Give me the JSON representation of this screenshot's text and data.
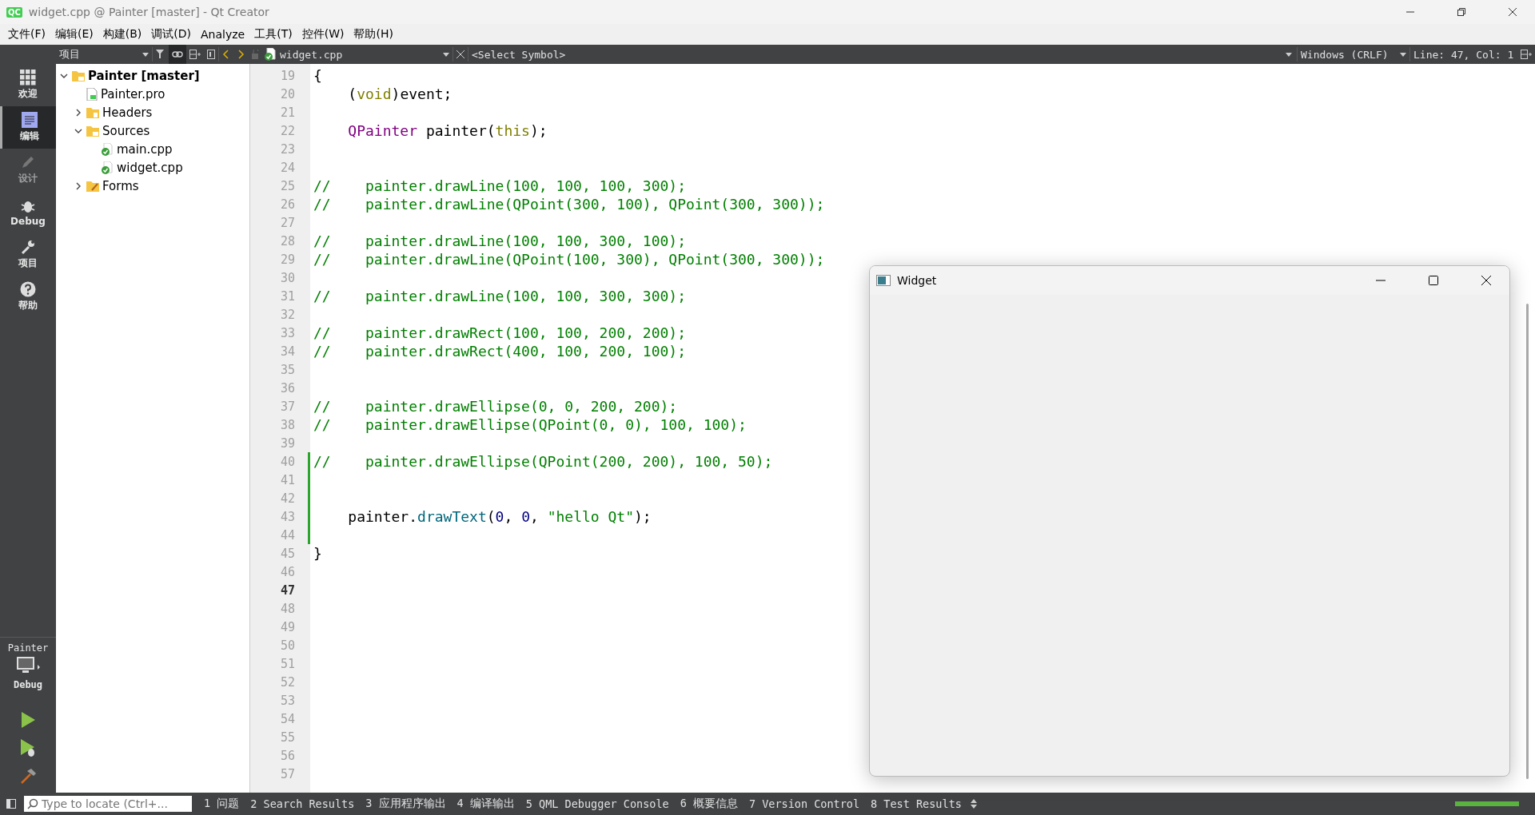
{
  "window": {
    "logo": "QC",
    "title": "widget.cpp @ Painter [master] - Qt Creator"
  },
  "menu": [
    "文件(F)",
    "编辑(E)",
    "构建(B)",
    "调试(D)",
    "Analyze",
    "工具(T)",
    "控件(W)",
    "帮助(H)"
  ],
  "toolbar": {
    "sidebar_view": "项目",
    "file": "widget.cpp",
    "symbol": "<Select Symbol>",
    "line_ending": "Windows (CRLF)",
    "position": "Line: 47, Col: 1"
  },
  "modes": [
    {
      "label": "欢迎",
      "kind": "grid",
      "selected": false,
      "disabled": false
    },
    {
      "label": "编辑",
      "kind": "doc",
      "selected": true,
      "disabled": false
    },
    {
      "label": "设计",
      "kind": "pencil",
      "selected": false,
      "disabled": true
    },
    {
      "label": "Debug",
      "kind": "bug",
      "selected": false,
      "disabled": false
    },
    {
      "label": "项目",
      "kind": "wrench",
      "selected": false,
      "disabled": false
    },
    {
      "label": "帮助",
      "kind": "help",
      "selected": false,
      "disabled": false
    }
  ],
  "kit": {
    "project": "Painter",
    "build": "Debug"
  },
  "tree": [
    {
      "label": "Painter [master]",
      "kind": "project",
      "expanded": true,
      "children": [
        {
          "label": "Painter.pro",
          "kind": "pro"
        },
        {
          "label": "Headers",
          "kind": "headers",
          "expanded": false
        },
        {
          "label": "Sources",
          "kind": "sources",
          "expanded": true,
          "children": [
            {
              "label": "main.cpp",
              "kind": "cpp"
            },
            {
              "label": "widget.cpp",
              "kind": "cpp"
            }
          ]
        },
        {
          "label": "Forms",
          "kind": "forms",
          "expanded": false
        }
      ]
    }
  ],
  "editor": {
    "lines": [
      {
        "number": "19",
        "current": false,
        "modified": false,
        "tokens": [
          {
            "t": "{",
            "kind": "plain"
          }
        ]
      },
      {
        "number": "20",
        "current": false,
        "modified": false,
        "tokens": [
          {
            "t": "    (",
            "kind": "plain"
          },
          {
            "t": "void",
            "kind": "keyword"
          },
          {
            "t": ")event;",
            "kind": "plain"
          }
        ]
      },
      {
        "number": "21",
        "current": false,
        "modified": false
      },
      {
        "number": "22",
        "current": false,
        "modified": false,
        "tokens": [
          {
            "t": "    QPainter",
            "kind": "type"
          },
          {
            "t": " painter(",
            "kind": "plain"
          },
          {
            "t": "this",
            "kind": "keyword"
          },
          {
            "t": ");",
            "kind": "plain"
          }
        ]
      },
      {
        "number": "23",
        "current": false,
        "modified": false
      },
      {
        "number": "24",
        "current": false,
        "modified": false
      },
      {
        "number": "25",
        "current": false,
        "modified": false,
        "tokens": [
          {
            "t": "//    painter.drawLine(100, 100, 100, 300);",
            "kind": "comment"
          }
        ]
      },
      {
        "number": "26",
        "current": false,
        "modified": false,
        "tokens": [
          {
            "t": "//    painter.drawLine(QPoint(300, 100), QPoint(300, 300));",
            "kind": "comment"
          }
        ]
      },
      {
        "number": "27",
        "current": false,
        "modified": false
      },
      {
        "number": "28",
        "current": false,
        "modified": false,
        "tokens": [
          {
            "t": "//    painter.drawLine(100, 100, 300, 100);",
            "kind": "comment"
          }
        ]
      },
      {
        "number": "29",
        "current": false,
        "modified": false,
        "tokens": [
          {
            "t": "//    painter.drawLine(QPoint(100, 300), QPoint(300, 300));",
            "kind": "comment"
          }
        ]
      },
      {
        "number": "30",
        "current": false,
        "modified": false
      },
      {
        "number": "31",
        "current": false,
        "modified": false,
        "tokens": [
          {
            "t": "//    painter.drawLine(100, 100, 300, 300);",
            "kind": "comment"
          }
        ]
      },
      {
        "number": "32",
        "current": false,
        "modified": false
      },
      {
        "number": "33",
        "current": false,
        "modified": false,
        "tokens": [
          {
            "t": "//    painter.drawRect(100, 100, 200, 200);",
            "kind": "comment"
          }
        ]
      },
      {
        "number": "34",
        "current": false,
        "modified": false,
        "tokens": [
          {
            "t": "//    painter.drawRect(400, 100, 200, 100);",
            "kind": "comment"
          }
        ]
      },
      {
        "number": "35",
        "current": false,
        "modified": false
      },
      {
        "number": "36",
        "current": false,
        "modified": false
      },
      {
        "number": "37",
        "current": false,
        "modified": false,
        "tokens": [
          {
            "t": "//    painter.drawEllipse(0, 0, 200, 200);",
            "kind": "comment"
          }
        ]
      },
      {
        "number": "38",
        "current": false,
        "modified": false,
        "tokens": [
          {
            "t": "//    painter.drawEllipse(QPoint(0, 0), 100, 100);",
            "kind": "comment"
          }
        ]
      },
      {
        "number": "39",
        "current": false,
        "modified": false
      },
      {
        "number": "40",
        "current": false,
        "modified": true,
        "tokens": [
          {
            "t": "//    painter.drawEllipse(QPoint(200, 200), 100, 50);",
            "kind": "comment"
          }
        ]
      },
      {
        "number": "41",
        "current": false,
        "modified": true
      },
      {
        "number": "42",
        "current": false,
        "modified": true
      },
      {
        "number": "43",
        "current": false,
        "modified": true,
        "tokens": [
          {
            "t": "    painter.",
            "kind": "plain"
          },
          {
            "t": "drawText",
            "kind": "function"
          },
          {
            "t": "(",
            "kind": "plain"
          },
          {
            "t": "0",
            "kind": "number"
          },
          {
            "t": ", ",
            "kind": "plain"
          },
          {
            "t": "0",
            "kind": "number"
          },
          {
            "t": ", ",
            "kind": "plain"
          },
          {
            "t": "\"hello Qt\"",
            "kind": "string"
          },
          {
            "t": ");",
            "kind": "plain"
          }
        ]
      },
      {
        "number": "44",
        "current": false,
        "modified": true
      },
      {
        "number": "45",
        "current": false,
        "modified": false,
        "tokens": [
          {
            "t": "}",
            "kind": "plain"
          }
        ]
      },
      {
        "number": "46",
        "current": false,
        "modified": false
      },
      {
        "number": "47",
        "current": true,
        "modified": false
      },
      {
        "number": "48",
        "current": false,
        "modified": false
      },
      {
        "number": "49",
        "current": false,
        "modified": false
      },
      {
        "number": "50",
        "current": false,
        "modified": false
      },
      {
        "number": "51",
        "current": false,
        "modified": false
      },
      {
        "number": "52",
        "current": false,
        "modified": false
      },
      {
        "number": "53",
        "current": false,
        "modified": false
      },
      {
        "number": "54",
        "current": false,
        "modified": false
      },
      {
        "number": "55",
        "current": false,
        "modified": false
      },
      {
        "number": "56",
        "current": false,
        "modified": false
      },
      {
        "number": "57",
        "current": false,
        "modified": false
      }
    ]
  },
  "widget_window": {
    "title": "Widget"
  },
  "status_bar": {
    "locator": {
      "placeholder": "Type to locate (Ctrl+..."
    },
    "panes": [
      "1 问题",
      "2 Search Results",
      "3 应用程序输出",
      "4 编译输出",
      "5 QML Debugger Console",
      "6 概要信息",
      "7 Version Control",
      "8 Test Results"
    ],
    "progress": {
      "level": 1
    }
  }
}
